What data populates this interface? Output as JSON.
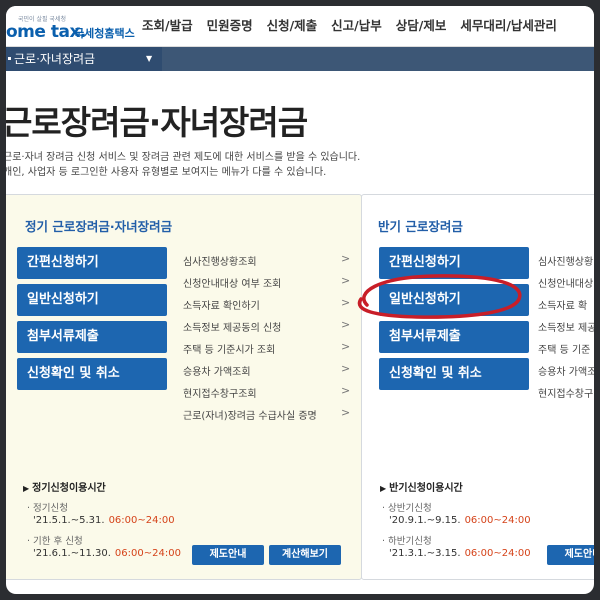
{
  "header": {
    "logo_small": "국민이 살필 국세청",
    "logo_main": "ome tax.",
    "logo_sub": "국세청홈택스",
    "nav": [
      "조회/발급",
      "민원증명",
      "신청/제출",
      "신고/납부",
      "상담/제보",
      "세무대리/납세관리"
    ]
  },
  "breadcrumb": {
    "label": "근로·자녀장려금"
  },
  "page": {
    "title": "근로장려금·자녀장려금",
    "desc1": "근로·자녀 장려금 신청 서비스 및 장려금 관련 제도에 대한 서비스를 받을 수 있습니다.",
    "desc2": "개인, 사업자 등 로그인한 사용자 유형별로 보여지는 메뉴가 다를 수 있습니다."
  },
  "left_panel": {
    "title": "정기 근로장려금·자녀장려금",
    "buttons": [
      "간편신청하기",
      "일반신청하기",
      "첨부서류제출",
      "신청확인 및 취소"
    ],
    "links": [
      "심사진행상황조회",
      "신청안내대상 여부 조회",
      "소득자료 확인하기",
      "소득정보 제공동의 신청",
      "주택 등 기준시가 조회",
      "승용차 가액조회",
      "현지접수창구조회",
      "근로(자녀)장려금 수급사실 증명"
    ],
    "chevron": ">",
    "time_heading": "정기신청이용시간",
    "times": [
      {
        "label": "정기신청",
        "date": "'21.5.1.~5.31.",
        "hours": "06:00~24:00"
      },
      {
        "label": "기한 후 신청",
        "date": "'21.6.1.~11.30.",
        "hours": "06:00~24:00"
      }
    ],
    "btn_guide": "제도안내",
    "btn_calc": "계산해보기"
  },
  "right_panel": {
    "title": "반기 근로장려금",
    "buttons": [
      "간편신청하기",
      "일반신청하기",
      "첨부서류제출",
      "신청확인 및 취소"
    ],
    "links": [
      "심사진행상황",
      "신청안내대상",
      "소득자료 확",
      "소득정보 제공",
      "주택 등 기준",
      "승용차 가액조",
      "현지접수창구"
    ],
    "time_heading": "반기신청이용시간",
    "times": [
      {
        "label": "상반기신청",
        "date": "'20.9.1.~9.15.",
        "hours": "06:00~24:00"
      },
      {
        "label": "하반기신청",
        "date": "'21.3.1.~3.15.",
        "hours": "06:00~24:00"
      }
    ],
    "btn_guide": "제도안내"
  },
  "colors": {
    "brand": "#1d66b0",
    "breadcrumb": "#3d5776",
    "annotation": "#c81e28",
    "time_highlight": "#d5431a"
  }
}
